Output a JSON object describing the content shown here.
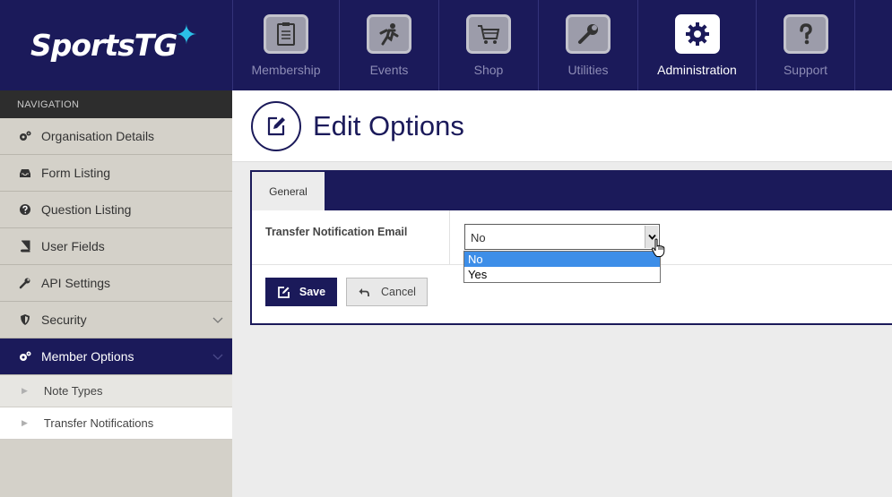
{
  "brand": {
    "logo_text": "SportsTG",
    "logo_star": "✦"
  },
  "top_nav": {
    "tabs": [
      {
        "label": "Membership",
        "icon": "clipboard-icon",
        "active": false
      },
      {
        "label": "Events",
        "icon": "runner-icon",
        "active": false
      },
      {
        "label": "Shop",
        "icon": "cart-icon",
        "active": false
      },
      {
        "label": "Utilities",
        "icon": "wrench-icon",
        "active": false
      },
      {
        "label": "Administration",
        "icon": "gear-icon",
        "active": true
      },
      {
        "label": "Support",
        "icon": "question-icon",
        "active": false
      }
    ]
  },
  "sidebar": {
    "heading": "NAVIGATION",
    "items": [
      {
        "label": "Organisation Details",
        "icon": "cogs-icon"
      },
      {
        "label": "Form Listing",
        "icon": "inbox-icon"
      },
      {
        "label": "Question Listing",
        "icon": "question-circle-icon"
      },
      {
        "label": "User Fields",
        "icon": "book-icon"
      },
      {
        "label": "API Settings",
        "icon": "wrench-icon"
      },
      {
        "label": "Security",
        "icon": "shield-icon"
      },
      {
        "label": "Member Options",
        "icon": "cogs-icon"
      }
    ],
    "sub_items": [
      {
        "label": "Note Types"
      },
      {
        "label": "Transfer Notifications"
      }
    ]
  },
  "page": {
    "title": "Edit Options"
  },
  "form": {
    "tab_label": "General",
    "field_label": "Transfer Notification Email",
    "select_value": "No",
    "options": [
      "No",
      "Yes"
    ],
    "highlighted_option": "No"
  },
  "buttons": {
    "save_label": "Save",
    "cancel_label": "Cancel"
  },
  "colors": {
    "navy": "#1b1a5a",
    "accent": "#2bc0e8",
    "highlight": "#3d8ee8"
  }
}
